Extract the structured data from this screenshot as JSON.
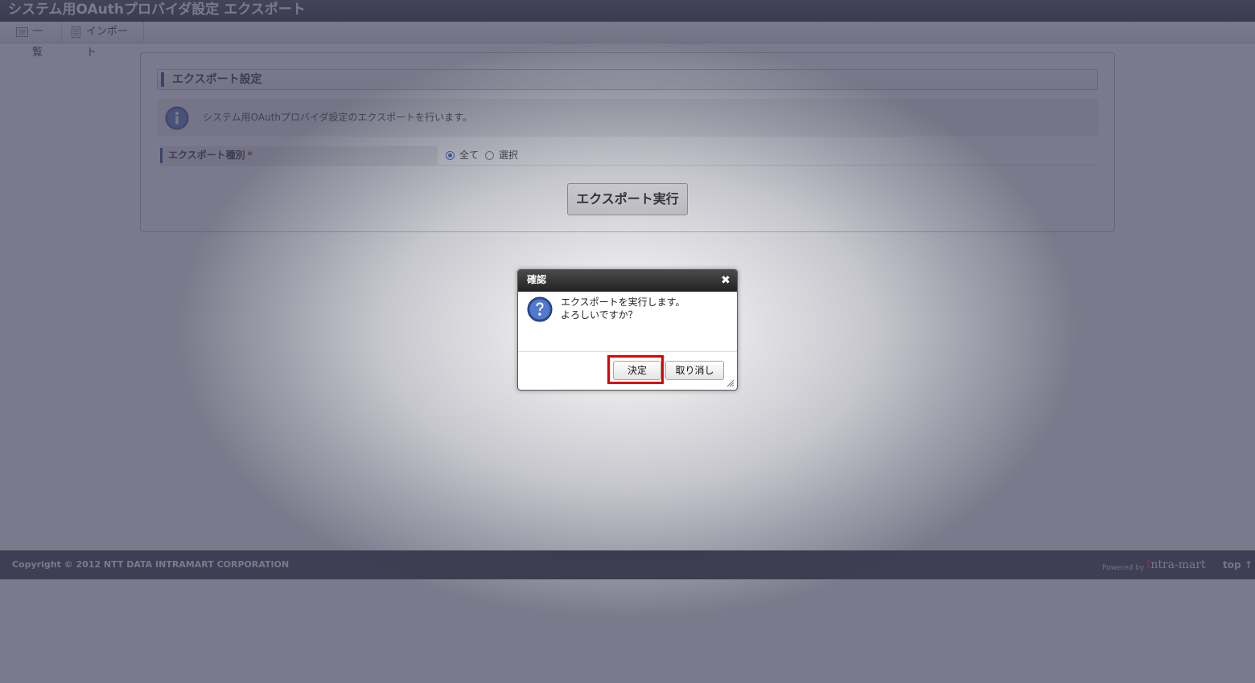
{
  "window": {
    "title": "システム用OAuthプロバイダ設定 エクスポート"
  },
  "toolbar": {
    "items": [
      {
        "label": "一覧",
        "icon": "list-icon"
      },
      {
        "label": "インポート",
        "icon": "import-icon"
      }
    ]
  },
  "section": {
    "title": "エクスポート設定",
    "info_text": "システム用OAuthプロバイダ設定のエクスポートを行います。"
  },
  "form": {
    "export_type": {
      "label": "エクスポート種別",
      "required_mark": "*",
      "options": [
        {
          "label": "全て",
          "selected": true
        },
        {
          "label": "選択",
          "selected": false
        }
      ]
    },
    "submit_label": "エクスポート実行"
  },
  "dialog": {
    "title": "確認",
    "close_symbol": "✖",
    "message_line1": "エクスポートを実行します。",
    "message_line2": "よろしいですか？",
    "ok_label": "決定",
    "cancel_label": "取り消し"
  },
  "footer": {
    "copyright": "Copyright © 2012 NTT DATA INTRAMART CORPORATION",
    "powered_by": "Powered by",
    "brand": "ntra-mart",
    "brand_mark": "i",
    "top_link": "top ↑"
  },
  "colors": {
    "accent_blue": "#1f3f8f",
    "highlight_red": "#e00000",
    "footer_bg": "#2a2a36"
  }
}
